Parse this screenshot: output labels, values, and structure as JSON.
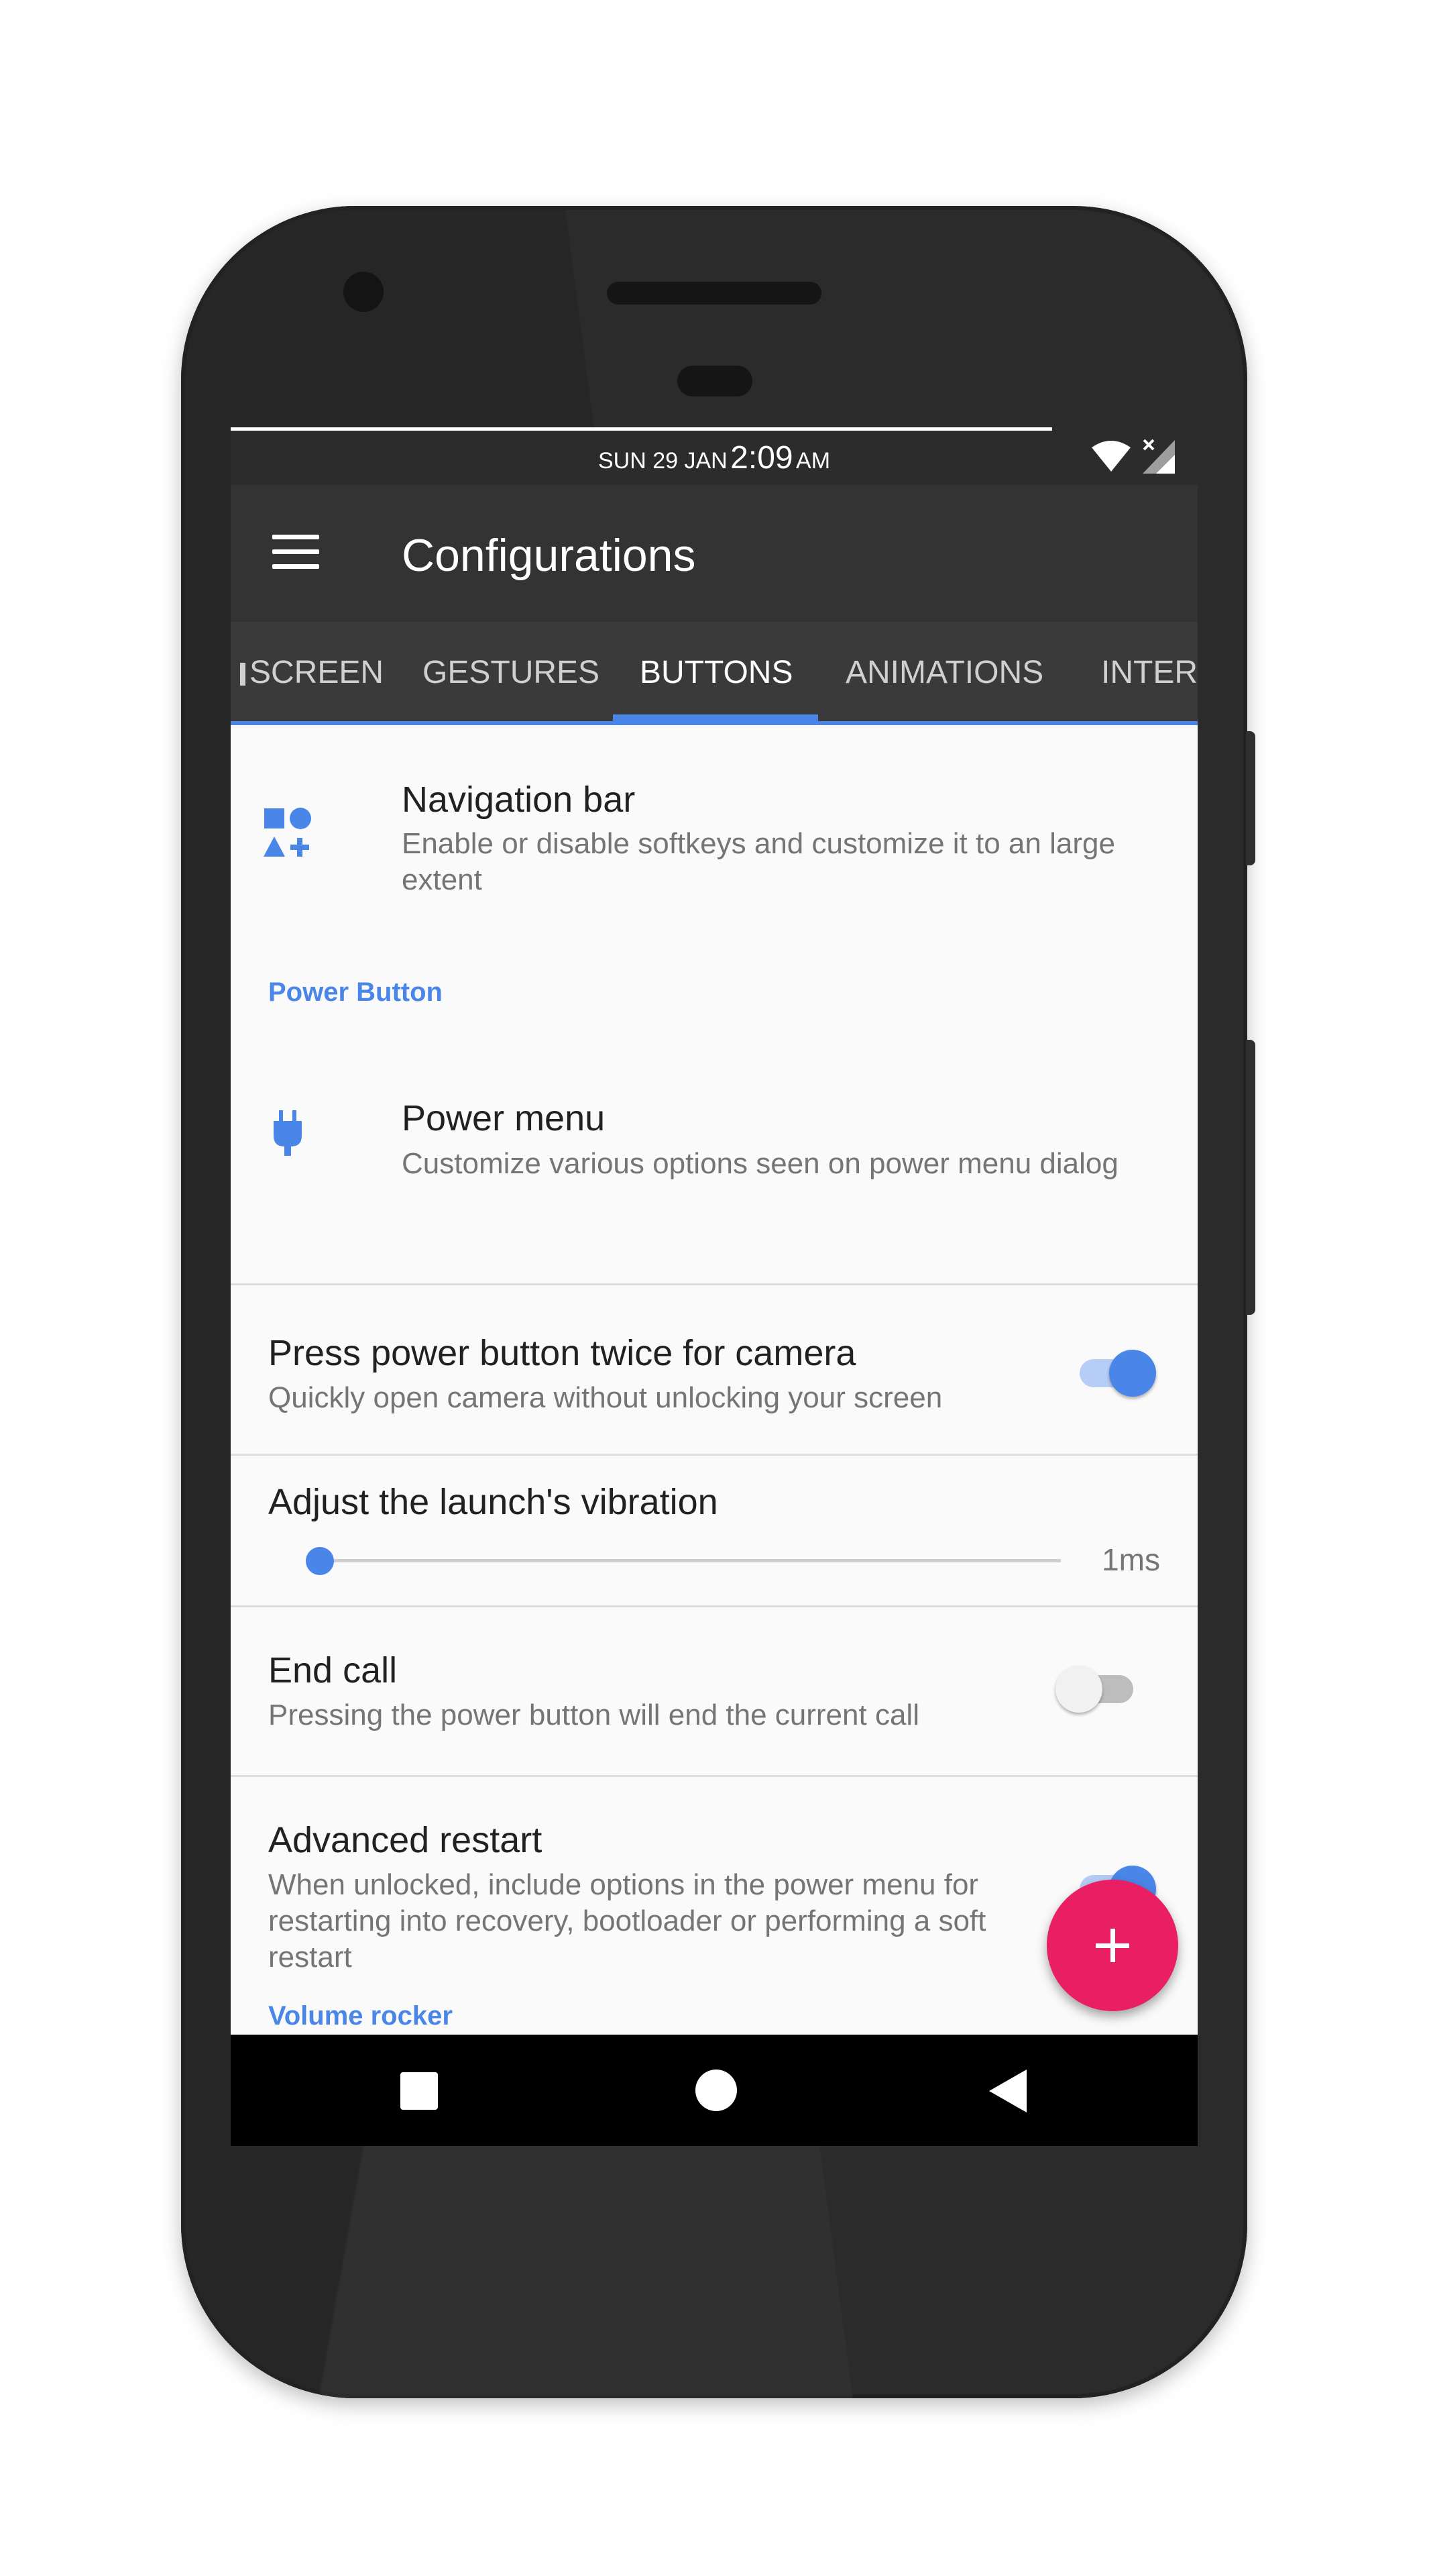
{
  "status_bar": {
    "date": "SUN 29 JAN",
    "time": "2:09",
    "ampm": "AM",
    "icons": [
      "wifi-icon",
      "signal-no-sim-icon"
    ]
  },
  "app_bar": {
    "menu_icon": "hamburger-menu-icon",
    "title": "Configurations"
  },
  "tabs": [
    {
      "label": "SCREEN",
      "visible_partial": "left"
    },
    {
      "label": "GESTURES"
    },
    {
      "label": "BUTTONS",
      "active": true
    },
    {
      "label": "ANIMATIONS"
    },
    {
      "label": "INTERF",
      "visible_partial": "right"
    }
  ],
  "preferences": {
    "navigation_bar": {
      "icon": "shapes-icon",
      "title": "Navigation bar",
      "summary": "Enable or disable softkeys and customize it to an large extent"
    },
    "power_button_category": "Power Button",
    "power_menu": {
      "icon": "power-plug-icon",
      "title": "Power menu",
      "summary": "Customize various options seen on power menu dialog"
    },
    "double_press_camera": {
      "title": "Press power button twice for camera",
      "summary": "Quickly open camera without unlocking your screen",
      "enabled": true
    },
    "launch_vibration": {
      "title": "Adjust the launch's vibration",
      "value_label": "1ms",
      "fraction": 0.0
    },
    "end_call": {
      "title": "End call",
      "summary": "Pressing the power button will end the current call",
      "enabled": false
    },
    "advanced_restart": {
      "title": "Advanced restart",
      "summary": "When unlocked, include options in the power menu for restarting into recovery, bootloader or performing a soft restart",
      "enabled": true
    },
    "volume_rocker_category": "Volume rocker"
  },
  "fab": {
    "icon": "plus-icon",
    "color": "#e91e63"
  },
  "nav_bar": {
    "icons": [
      "recent-apps-icon",
      "home-icon",
      "back-icon"
    ]
  },
  "colors": {
    "accent": "#4a86e8",
    "appbar": "#333333",
    "tabbar": "#3a3a3a",
    "fab": "#e91e63"
  }
}
